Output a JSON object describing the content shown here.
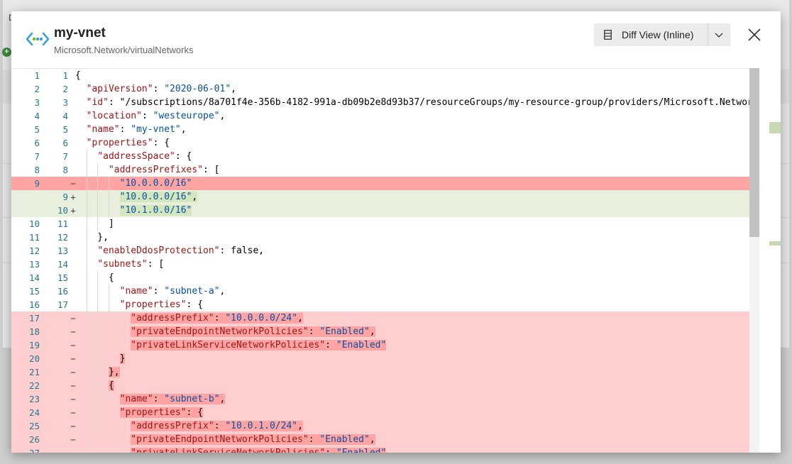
{
  "background": {
    "letter": "D",
    "add_label": "+"
  },
  "dialog": {
    "title": "my-vnet",
    "subtitle": "Microsoft.Network/virtualNetworks",
    "diff_button_label": "Diff View (Inline)"
  },
  "colors": {
    "removed": "#ffcfcf",
    "removed_strong": "#ffa3a3",
    "added": "#e8f0dd",
    "key": "#a31515",
    "string": "#0451a5",
    "line_number": "#237893"
  },
  "lines": [
    {
      "left": "1",
      "right": "1",
      "marker": "",
      "type": "ctx",
      "text": "{"
    },
    {
      "left": "2",
      "right": "2",
      "marker": "",
      "type": "ctx",
      "text": "  \"apiVersion\": \"2020-06-01\","
    },
    {
      "left": "3",
      "right": "3",
      "marker": "",
      "type": "ctx",
      "text": "  \"id\": \"/subscriptions/8a701f4e-356b-4182-991a-db09b2e8d93b37/resourceGroups/my-resource-group/providers/Microsoft.Network"
    },
    {
      "left": "4",
      "right": "4",
      "marker": "",
      "type": "ctx",
      "text": "  \"location\": \"westeurope\","
    },
    {
      "left": "5",
      "right": "5",
      "marker": "",
      "type": "ctx",
      "text": "  \"name\": \"my-vnet\","
    },
    {
      "left": "6",
      "right": "6",
      "marker": "",
      "type": "ctx",
      "text": "  \"properties\": {"
    },
    {
      "left": "7",
      "right": "7",
      "marker": "",
      "type": "ctx",
      "text": "    \"addressSpace\": {"
    },
    {
      "left": "8",
      "right": "8",
      "marker": "",
      "type": "ctx",
      "text": "      \"addressPrefixes\": ["
    },
    {
      "left": "9",
      "right": "",
      "marker": "−",
      "type": "del-strong",
      "text": "        \"10.0.0.0/16\""
    },
    {
      "left": "",
      "right": "9",
      "marker": "+",
      "type": "add",
      "text": "        \"10.0.0.0/16\","
    },
    {
      "left": "",
      "right": "10",
      "marker": "+",
      "type": "add",
      "text": "        \"10.1.0.0/16\""
    },
    {
      "left": "10",
      "right": "11",
      "marker": "",
      "type": "ctx",
      "text": "      ]"
    },
    {
      "left": "11",
      "right": "12",
      "marker": "",
      "type": "ctx",
      "text": "    },"
    },
    {
      "left": "12",
      "right": "13",
      "marker": "",
      "type": "ctx",
      "text": "    \"enableDdosProtection\": false,"
    },
    {
      "left": "13",
      "right": "14",
      "marker": "",
      "type": "ctx",
      "text": "    \"subnets\": ["
    },
    {
      "left": "14",
      "right": "15",
      "marker": "",
      "type": "ctx",
      "text": "      {"
    },
    {
      "left": "15",
      "right": "16",
      "marker": "",
      "type": "ctx",
      "text": "        \"name\": \"subnet-a\","
    },
    {
      "left": "16",
      "right": "17",
      "marker": "",
      "type": "ctx",
      "text": "        \"properties\": {"
    },
    {
      "left": "17",
      "right": "",
      "marker": "−",
      "type": "del",
      "text": "          \"addressPrefix\": \"10.0.0.0/24\","
    },
    {
      "left": "18",
      "right": "",
      "marker": "−",
      "type": "del",
      "text": "          \"privateEndpointNetworkPolicies\": \"Enabled\","
    },
    {
      "left": "19",
      "right": "",
      "marker": "−",
      "type": "del",
      "text": "          \"privateLinkServiceNetworkPolicies\": \"Enabled\""
    },
    {
      "left": "20",
      "right": "",
      "marker": "−",
      "type": "del",
      "text": "        }"
    },
    {
      "left": "21",
      "right": "",
      "marker": "−",
      "type": "del",
      "text": "      },"
    },
    {
      "left": "22",
      "right": "",
      "marker": "−",
      "type": "del",
      "text": "      {"
    },
    {
      "left": "23",
      "right": "",
      "marker": "−",
      "type": "del",
      "text": "        \"name\": \"subnet-b\","
    },
    {
      "left": "24",
      "right": "",
      "marker": "−",
      "type": "del",
      "text": "        \"properties\": {"
    },
    {
      "left": "25",
      "right": "",
      "marker": "−",
      "type": "del",
      "text": "          \"addressPrefix\": \"10.0.1.0/24\","
    },
    {
      "left": "26",
      "right": "",
      "marker": "−",
      "type": "del",
      "text": "          \"privateEndpointNetworkPolicies\": \"Enabled\","
    },
    {
      "left": "27",
      "right": "",
      "marker": "−",
      "type": "del",
      "text": "          \"privateLinkServiceNetworkPolicies\": \"Enabled\""
    }
  ]
}
